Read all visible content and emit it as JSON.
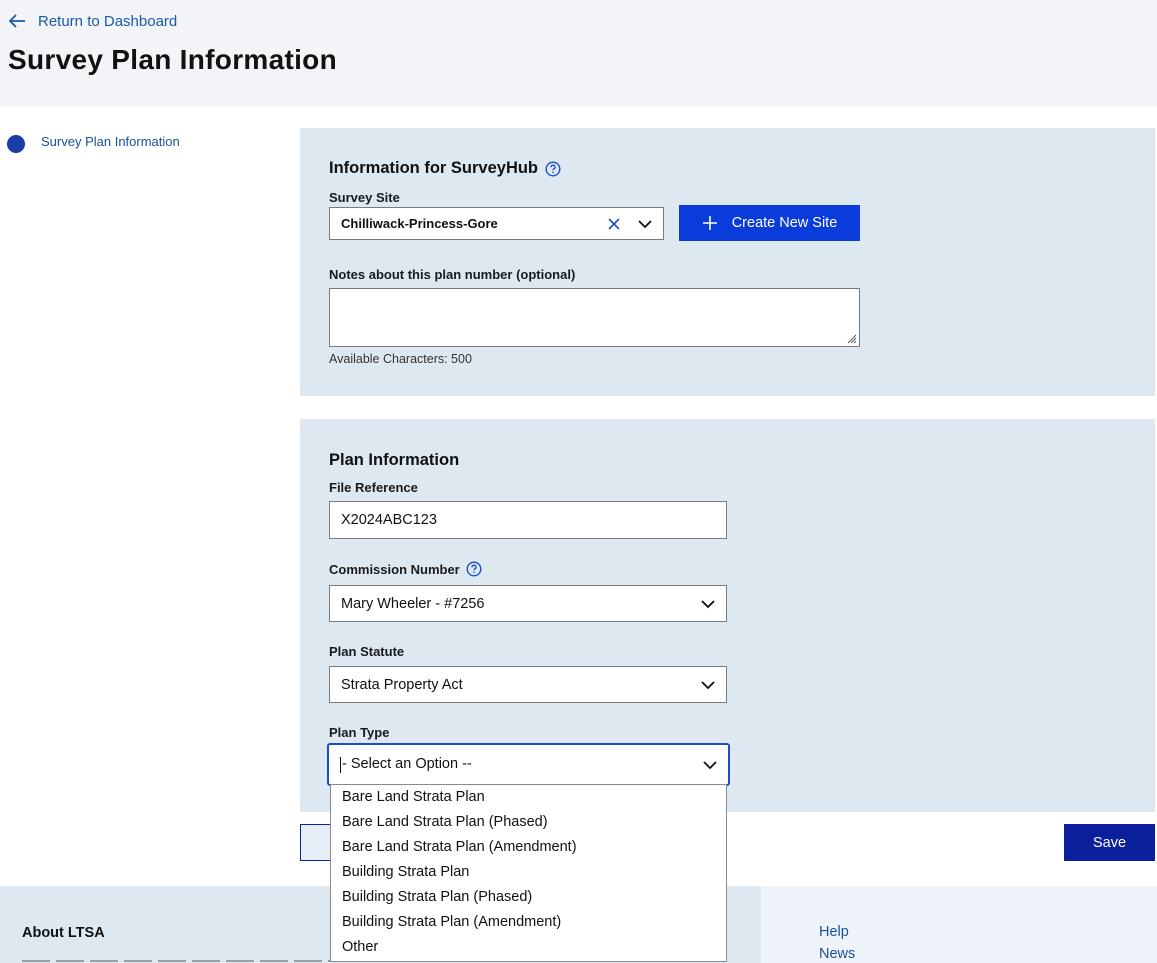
{
  "header": {
    "back_label": "Return to Dashboard",
    "title": "Survey Plan Information"
  },
  "sidebar": {
    "items": [
      {
        "label": "Survey Plan Information",
        "active": true
      }
    ]
  },
  "surveyhub": {
    "title": "Information for SurveyHub",
    "site_label": "Survey Site",
    "site_value": "Chilliwack-Princess-Gore",
    "create_site_label": "Create New Site",
    "notes_label": "Notes about this plan number (optional)",
    "notes_value": "",
    "chars_label": "Available Characters: 500"
  },
  "plan": {
    "title": "Plan Information",
    "file_ref_label": "File Reference",
    "file_ref_value": "X2024ABC123",
    "commission_label": "Commission Number",
    "commission_value": "Mary Wheeler - #7256",
    "statute_label": "Plan Statute",
    "statute_value": "Strata Property Act",
    "type_label": "Plan Type",
    "type_value": "- Select an Option --",
    "type_options": [
      "Bare Land Strata Plan",
      "Bare Land Strata Plan (Phased)",
      "Bare Land Strata Plan (Amendment)",
      "Building Strata Plan",
      "Building Strata Plan (Phased)",
      "Building Strata Plan (Amendment)",
      "Other"
    ]
  },
  "actions": {
    "save_label": "Save"
  },
  "footer": {
    "about_title": "About LTSA",
    "links": [
      "Help",
      "News"
    ]
  },
  "colors": {
    "accent": "#0a3cdc",
    "save": "#0c1f9c",
    "panel": "#dde8f1",
    "link": "#1a4f9c"
  },
  "icons": [
    "arrow-left-icon",
    "help-circle-icon",
    "clear-x-icon",
    "chevron-down-icon",
    "plus-icon",
    "resize-grip-icon"
  ]
}
